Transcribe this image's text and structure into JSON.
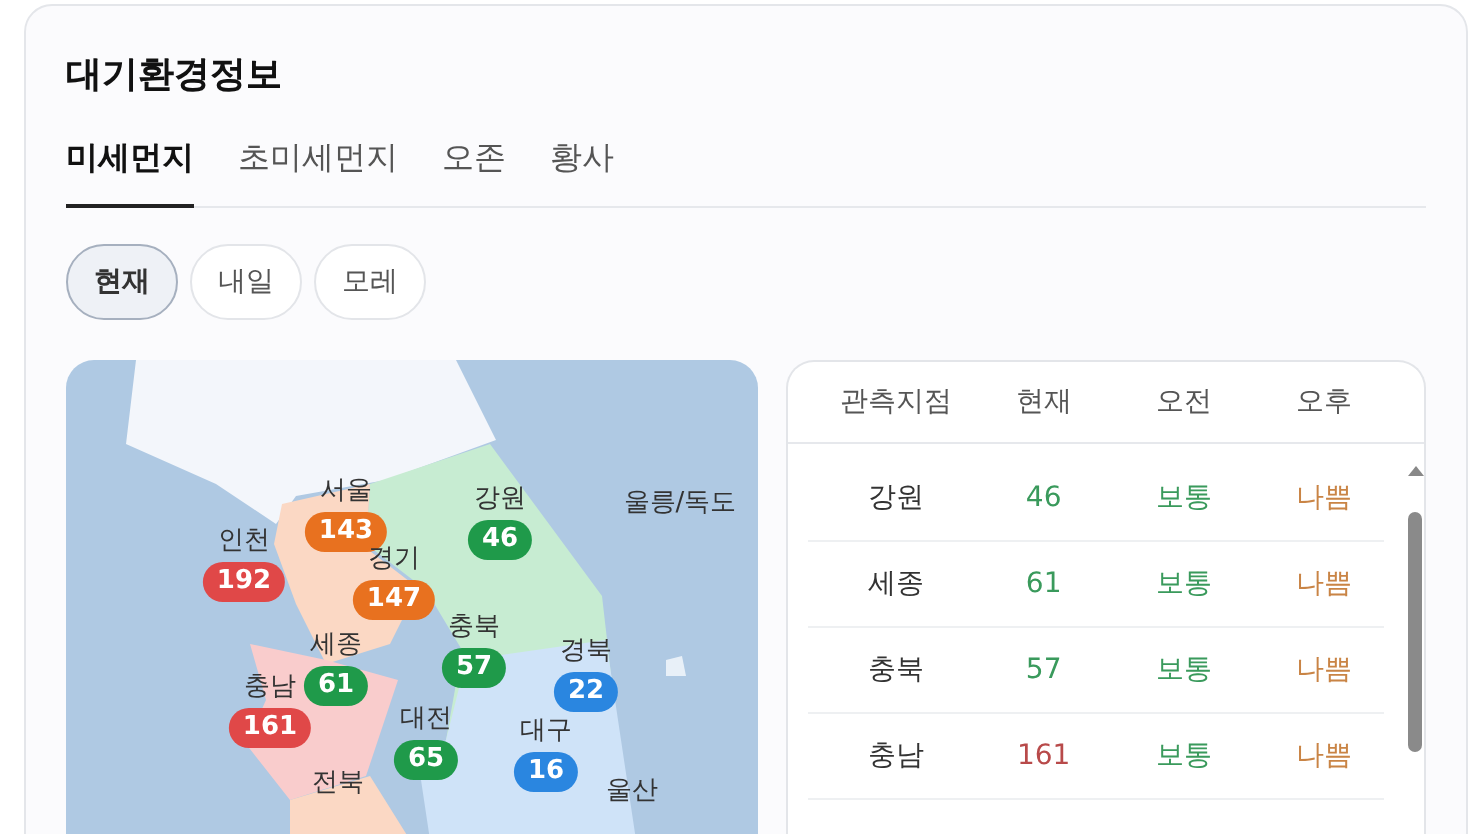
{
  "title": "대기환경정보",
  "tabs": [
    {
      "label": "미세먼지",
      "selected": true
    },
    {
      "label": "초미세먼지",
      "selected": false
    },
    {
      "label": "오존",
      "selected": false
    },
    {
      "label": "황사",
      "selected": false
    }
  ],
  "days": [
    {
      "label": "현재",
      "selected": true
    },
    {
      "label": "내일",
      "selected": false
    },
    {
      "label": "모레",
      "selected": false
    }
  ],
  "map": {
    "markers": [
      {
        "label": "서울",
        "value": "143",
        "color": "#e8711f"
      },
      {
        "label": "강원",
        "value": "46",
        "color": "#1f9a4a"
      },
      {
        "label": "울릉/독도"
      },
      {
        "label": "인천",
        "value": "192",
        "color": "#e04848"
      },
      {
        "label": "경기",
        "value": "147",
        "color": "#e8711f"
      },
      {
        "label": "충북",
        "value": "57",
        "color": "#1f9a4a"
      },
      {
        "label": "세종",
        "value": "61",
        "color": "#1f9a4a"
      },
      {
        "label": "경북",
        "value": "22",
        "color": "#2a86e0"
      },
      {
        "label": "충남",
        "value": "161",
        "color": "#e04848"
      },
      {
        "label": "대전",
        "value": "65",
        "color": "#1f9a4a"
      },
      {
        "label": "대구",
        "value": "16",
        "color": "#2a86e0"
      },
      {
        "label": "울산"
      },
      {
        "label": "전북"
      }
    ]
  },
  "table": {
    "columns": [
      "관측지점",
      "현재",
      "오전",
      "오후"
    ],
    "rows": [
      {
        "cells": [
          {
            "text": "강원"
          },
          {
            "text": "46",
            "color": "#3a9a5c"
          },
          {
            "text": "보통",
            "color": "#3a9a5c"
          },
          {
            "text": "나쁨",
            "color": "#c98445"
          }
        ]
      },
      {
        "cells": [
          {
            "text": "세종"
          },
          {
            "text": "61",
            "color": "#3a9a5c"
          },
          {
            "text": "보통",
            "color": "#3a9a5c"
          },
          {
            "text": "나쁨",
            "color": "#c98445"
          }
        ]
      },
      {
        "cells": [
          {
            "text": "충북"
          },
          {
            "text": "57",
            "color": "#3a9a5c"
          },
          {
            "text": "보통",
            "color": "#3a9a5c"
          },
          {
            "text": "나쁨",
            "color": "#c98445"
          }
        ]
      },
      {
        "cells": [
          {
            "text": "충남"
          },
          {
            "text": "161",
            "color": "#b84a4a"
          },
          {
            "text": "보통",
            "color": "#3a9a5c"
          },
          {
            "text": "나쁨",
            "color": "#c98445"
          }
        ]
      }
    ]
  }
}
